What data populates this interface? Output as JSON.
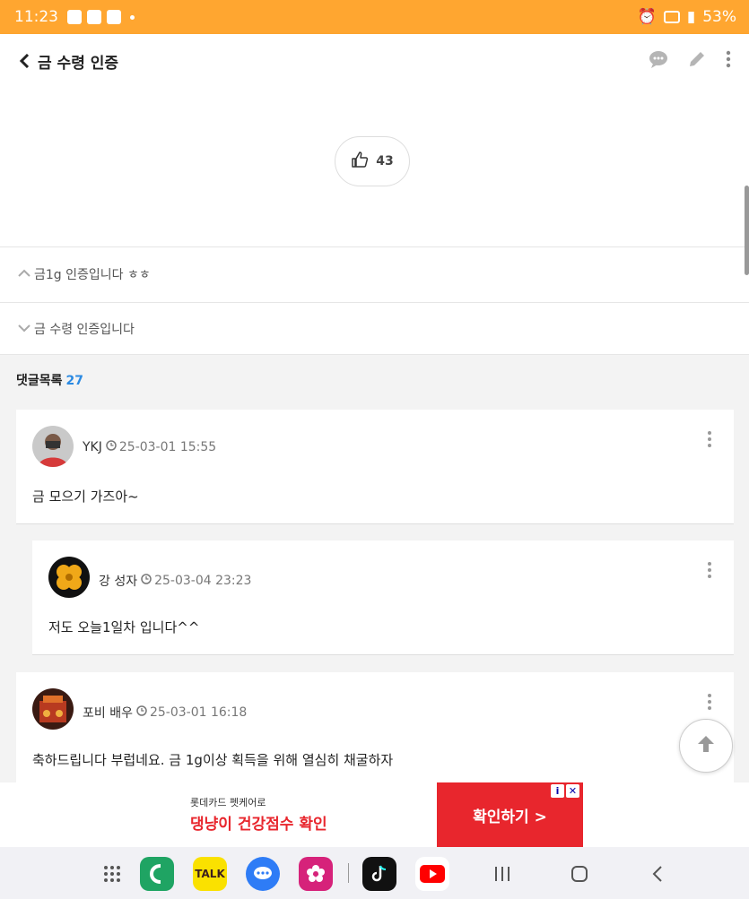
{
  "status_bar": {
    "time": "11:23",
    "battery": "53%"
  },
  "header": {
    "title": "금 수령 인증"
  },
  "like": {
    "count": "43"
  },
  "post_nav": {
    "prev_title": "금1g 인증입니다 ㅎㅎ",
    "next_title": "금 수령 인증입니다"
  },
  "comments": {
    "heading": "댓글목록",
    "count": "27",
    "items": [
      {
        "author": "YKJ",
        "date": "25-03-01 15:55",
        "text": "금 모으기 가즈아~"
      },
      {
        "author": "강 성자",
        "date": "25-03-04 23:23",
        "text": "저도 오늘1일차 입니다^^"
      },
      {
        "author": "포비 배우",
        "date": "25-03-01 16:18",
        "text": "축하드립니다 부럽네요.  금 1g이상 획득을 위해 열심히 채굴하자"
      }
    ]
  },
  "ad": {
    "small_text": "롯데카드 펫케어로",
    "big_text": "댕냥이 건강점수 확인",
    "button_text": "확인하기 >"
  },
  "dock": {
    "talk_label": "TALK"
  }
}
